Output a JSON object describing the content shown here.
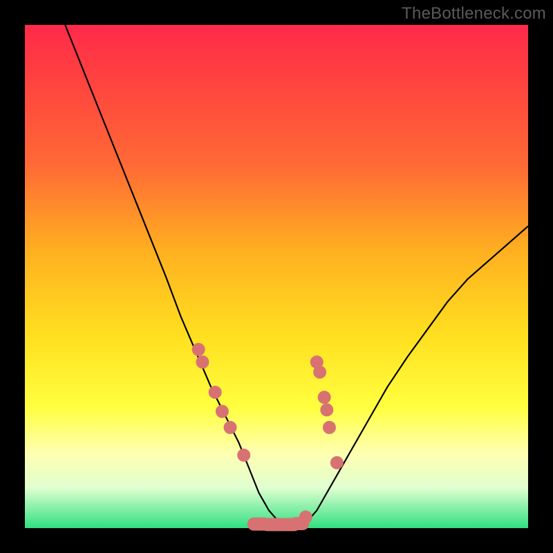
{
  "watermark": "TheBottleneck.com",
  "chart_data": {
    "type": "line",
    "title": "",
    "xlabel": "",
    "ylabel": "",
    "xlim": [
      0,
      100
    ],
    "ylim": [
      0,
      100
    ],
    "grid": false,
    "series": [
      {
        "name": "bottleneck-curve",
        "x": [
          8,
          12,
          16,
          20,
          24,
          28,
          31,
          34,
          37,
          40,
          42.5,
          44.5,
          46.5,
          48.5,
          50.5,
          52,
          54,
          56,
          58,
          60,
          64,
          68,
          72,
          76,
          80,
          84,
          88,
          92,
          96,
          100
        ],
        "values": [
          100,
          90,
          80,
          70,
          60,
          50,
          42,
          35,
          28,
          22,
          17,
          12,
          7,
          3.5,
          1.2,
          0.6,
          0.6,
          1.2,
          3.5,
          7,
          14,
          21,
          28,
          34,
          39.5,
          45,
          49.5,
          53,
          56.5,
          60
        ]
      }
    ],
    "markers_left": [
      {
        "x": 34.5,
        "y": 35.5
      },
      {
        "x": 35.3,
        "y": 33.0
      },
      {
        "x": 37.8,
        "y": 27.0
      },
      {
        "x": 39.2,
        "y": 23.2
      },
      {
        "x": 40.8,
        "y": 20.0
      },
      {
        "x": 43.5,
        "y": 14.5
      }
    ],
    "markers_right": [
      {
        "x": 58.0,
        "y": 33.0
      },
      {
        "x": 58.6,
        "y": 31.0
      },
      {
        "x": 59.5,
        "y": 26.0
      },
      {
        "x": 60.0,
        "y": 23.5
      },
      {
        "x": 60.5,
        "y": 20.0
      },
      {
        "x": 62.0,
        "y": 13.0
      }
    ],
    "bottom_pills": [
      {
        "x0": 45.5,
        "x1": 47.5,
        "y": 0.8
      },
      {
        "x0": 48.2,
        "x1": 51.0,
        "y": 0.7
      },
      {
        "x0": 51.5,
        "x1": 53.5,
        "y": 0.7
      },
      {
        "x0": 53.8,
        "x1": 55.2,
        "y": 0.9
      }
    ],
    "bottom_dots": [
      {
        "x": 55.8,
        "y": 2.2
      }
    ],
    "background_gradient": {
      "top": "#ff2a4a",
      "mid": "#ffe020",
      "bottom": "#30e080"
    }
  }
}
